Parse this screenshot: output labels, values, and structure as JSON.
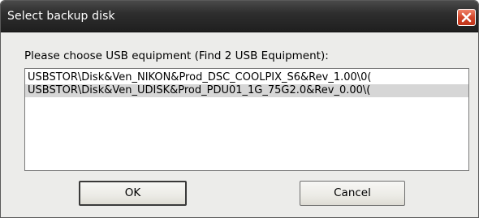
{
  "window": {
    "title": "Select backup disk",
    "close_icon": "close-icon"
  },
  "prompt": "Please choose USB equipment (Find 2 USB Equipment):",
  "devices": [
    {
      "label": "USBSTOR\\Disk&Ven_NIKON&Prod_DSC_COOLPIX_S6&Rev_1.00\\0(",
      "selected": false
    },
    {
      "label": "USBSTOR\\Disk&Ven_UDISK&Prod_PDU01_1G_75G2.0&Rev_0.00\\(",
      "selected": true
    }
  ],
  "buttons": {
    "ok_label": "OK",
    "cancel_label": "Cancel"
  },
  "colors": {
    "title_bar": "#2e2e2e",
    "close_button": "#d2462a",
    "selection": "#d6d6d6"
  }
}
